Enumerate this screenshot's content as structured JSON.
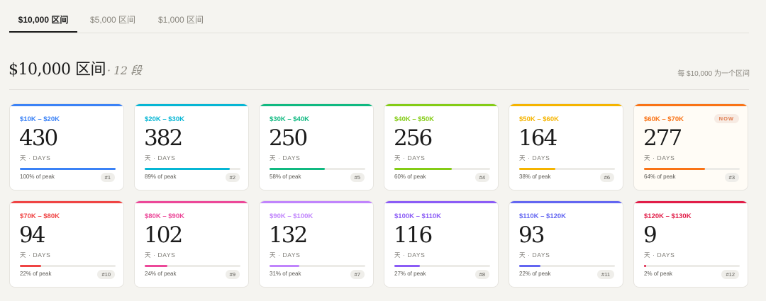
{
  "tabs": [
    {
      "label": "$10,000 区间",
      "active": true
    },
    {
      "label": "$5,000 区间",
      "active": false
    },
    {
      "label": "$1,000 区间",
      "active": false
    }
  ],
  "section": {
    "title": "$10,000 区间",
    "subtitle": "· 12 段",
    "note": "每 $10,000 为一个区间"
  },
  "unit_label": "天 · DAYS",
  "now_label": "NOW",
  "cards": [
    {
      "range": "$10K – $20K",
      "days": "430",
      "fill_fraction": 1.0,
      "pct": "100% of peak",
      "rank": "#1",
      "color": "#3b82f6",
      "now": false
    },
    {
      "range": "$20K – $30K",
      "days": "382",
      "fill_fraction": 0.89,
      "pct": "89% of peak",
      "rank": "#2",
      "color": "#06b6d4",
      "now": false
    },
    {
      "range": "$30K – $40K",
      "days": "250",
      "fill_fraction": 0.58,
      "pct": "58% of peak",
      "rank": "#5",
      "color": "#10b981",
      "now": false
    },
    {
      "range": "$40K – $50K",
      "days": "256",
      "fill_fraction": 0.6,
      "pct": "60% of peak",
      "rank": "#4",
      "color": "#84cc16",
      "now": false
    },
    {
      "range": "$50K – $60K",
      "days": "164",
      "fill_fraction": 0.38,
      "pct": "38% of peak",
      "rank": "#6",
      "color": "#f5b400",
      "now": false
    },
    {
      "range": "$60K – $70K",
      "days": "277",
      "fill_fraction": 0.64,
      "pct": "64% of peak",
      "rank": "#3",
      "color": "#f97316",
      "now": true
    },
    {
      "range": "$70K – $80K",
      "days": "94",
      "fill_fraction": 0.22,
      "pct": "22% of peak",
      "rank": "#10",
      "color": "#ef4444",
      "now": false
    },
    {
      "range": "$80K – $90K",
      "days": "102",
      "fill_fraction": 0.24,
      "pct": "24% of peak",
      "rank": "#9",
      "color": "#ec4899",
      "now": false
    },
    {
      "range": "$90K – $100K",
      "days": "132",
      "fill_fraction": 0.31,
      "pct": "31% of peak",
      "rank": "#7",
      "color": "#c084fc",
      "now": false
    },
    {
      "range": "$100K – $110K",
      "days": "116",
      "fill_fraction": 0.27,
      "pct": "27% of peak",
      "rank": "#8",
      "color": "#8b5cf6",
      "now": false
    },
    {
      "range": "$110K – $120K",
      "days": "93",
      "fill_fraction": 0.22,
      "pct": "22% of peak",
      "rank": "#11",
      "color": "#6366f1",
      "now": false
    },
    {
      "range": "$120K – $130K",
      "days": "9",
      "fill_fraction": 0.02,
      "pct": "2% of peak",
      "rank": "#12",
      "color": "#e11d48",
      "now": false
    }
  ]
}
